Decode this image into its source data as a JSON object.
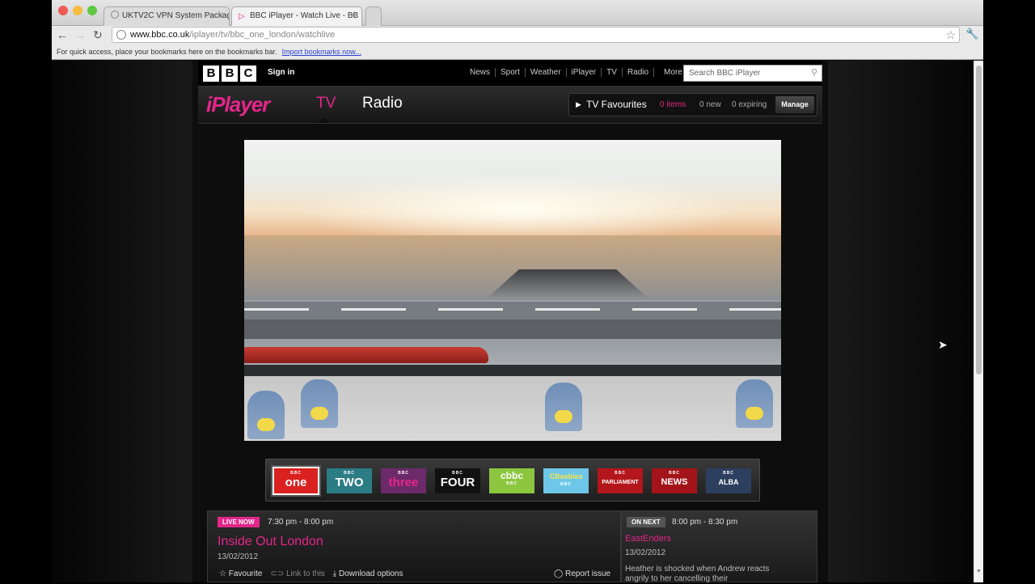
{
  "browser": {
    "tabs": [
      {
        "title": "UKTV2C VPN System Packag",
        "active": false
      },
      {
        "title": "BBC iPlayer - Watch Live - BB",
        "active": true
      }
    ],
    "url_host": "www.bbc.co.uk",
    "url_path": "/iplayer/tv/bbc_one_london/watchlive",
    "bookmarks_prompt": "For quick access, place your bookmarks here on the bookmarks bar.",
    "import_link": "Import bookmarks now..."
  },
  "bbc": {
    "logo_letters": [
      "B",
      "B",
      "C"
    ],
    "sign_in": "Sign in",
    "nav": [
      "News",
      "Sport",
      "Weather",
      "iPlayer",
      "TV",
      "Radio",
      "More"
    ],
    "search_placeholder": "Search BBC iPlayer"
  },
  "iplayer": {
    "logo": "iPlayer",
    "tabs": {
      "tv": "TV",
      "radio": "Radio"
    },
    "favourites": {
      "title": "TV Favourites",
      "items": "0 items",
      "new": "0 new",
      "expiring": "0 expiring",
      "manage": "Manage"
    }
  },
  "channels": [
    {
      "brand": "BBC",
      "name": "one",
      "bg": "#d9221f",
      "selected": true
    },
    {
      "brand": "BBC",
      "name": "TWO",
      "bg": "#2c7c85",
      "selected": false
    },
    {
      "brand": "BBC",
      "name": "three",
      "bg": "#6d2a6a",
      "selected": false
    },
    {
      "brand": "BBC",
      "name": "FOUR",
      "bg": "#111111",
      "selected": false
    },
    {
      "brand": "cbbc",
      "name": "BBC",
      "bg": "#8cc63f",
      "selected": false
    },
    {
      "brand": "CBeebies",
      "name": "BBC",
      "bg": "#6ec7e8",
      "selected": false
    },
    {
      "brand": "BBC",
      "name": "PARLIAMENT",
      "bg": "#b3161b",
      "selected": false
    },
    {
      "brand": "BBC",
      "name": "NEWS",
      "bg": "#a3141a",
      "selected": false
    },
    {
      "brand": "BBC",
      "name": "ALBA",
      "bg": "#2d3f5e",
      "selected": false
    }
  ],
  "now": {
    "badge": "LIVE NOW",
    "time": "7:30 pm - 8:00 pm",
    "title": "Inside Out London",
    "date": "13/02/2012",
    "actions": {
      "favourite": "Favourite",
      "link": "Link to this",
      "download": "Download options",
      "report": "Report issue"
    }
  },
  "next": {
    "badge": "ON NEXT",
    "time": "8:00 pm - 8:30 pm",
    "title": "EastEnders",
    "date": "13/02/2012",
    "description": "Heather is shocked when Andrew reacts angrily to her cancelling their"
  },
  "colors": {
    "accent": "#e3268a"
  }
}
